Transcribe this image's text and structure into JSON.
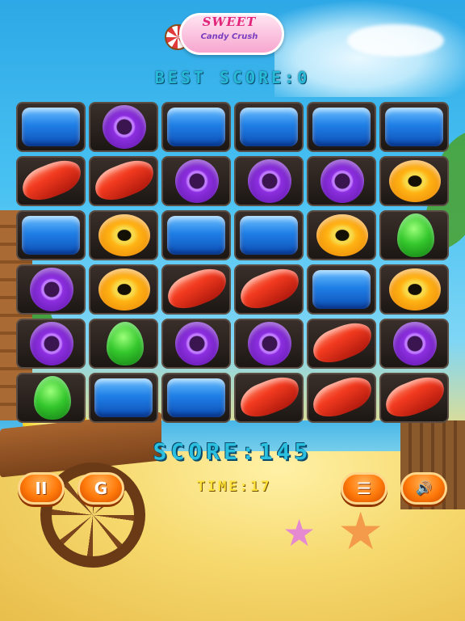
{
  "logo": {
    "title": "SWEET",
    "subtitle": "Candy Crush"
  },
  "best_score": {
    "label": "BEST SCORE:0"
  },
  "score": {
    "label": "SCORE:145"
  },
  "time": {
    "label": "TIME:17"
  },
  "buttons": {
    "pause": {
      "icon": "pause-icon",
      "glyph": "II"
    },
    "restart": {
      "icon": "restart-icon",
      "glyph": "G"
    },
    "menu": {
      "icon": "menu-list-icon",
      "glyph": "☰"
    },
    "sound": {
      "icon": "speaker-icon",
      "glyph": "🔊"
    }
  },
  "board": {
    "rows": 6,
    "cols": 6,
    "grid": [
      [
        "blue",
        "purple",
        "blue",
        "blue",
        "blue",
        "blue"
      ],
      [
        "red",
        "red",
        "purple",
        "purple",
        "purple",
        "yellow"
      ],
      [
        "blue",
        "yellow",
        "blue",
        "blue",
        "yellow",
        "green"
      ],
      [
        "purple",
        "yellow",
        "red",
        "red",
        "blue",
        "yellow"
      ],
      [
        "purple",
        "green",
        "purple",
        "purple",
        "red",
        "purple"
      ],
      [
        "green",
        "blue",
        "blue",
        "red",
        "red",
        "red"
      ]
    ]
  },
  "colors": {
    "accent_text": "#2bc0e0",
    "time_text": "#ffe23a",
    "button_orange": "#ff7a0a"
  }
}
